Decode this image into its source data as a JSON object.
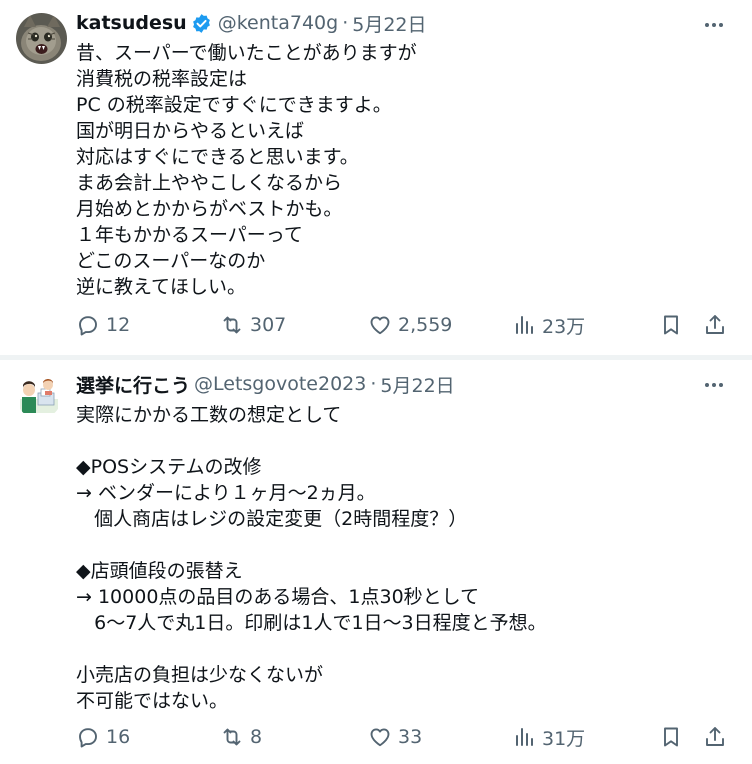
{
  "posts": [
    {
      "author_name": "katsudesu",
      "handle": "@kenta740g",
      "separator": "·",
      "date": "5月22日",
      "verified": true,
      "avatar_icon": "cat-avatar-icon",
      "text": "昔、スーパーで働いたことがありますが\n消費税の税率設定は\nPC の税率設定ですぐにできますよ。\n国が明日からやるといえば\n対応はすぐにできると思います。\nまあ会計上ややこしくなるから\n月始めとかからがベストかも。\n１年もかかるスーパーって\nどこのスーパーなのか\n逆に教えてほしい。",
      "replies": "12",
      "reposts": "307",
      "likes": "2,559",
      "views": "23万"
    },
    {
      "author_name": "選挙に行こう",
      "handle": "@Letsgovote2023",
      "separator": "·",
      "date": "5月22日",
      "verified": false,
      "avatar_icon": "voting-illustration-avatar-icon",
      "text": "実際にかかる工数の想定として\n\n◆POSシステムの改修\n→ ベンダーにより１ヶ月〜2ヵ月。\n   個人商店はレジの設定変更（2時間程度？）\n\n◆店頭値段の張替え\n→ 10000点の品目のある場合、1点30秒として\n   6〜7人で丸1日。印刷は1人で1日〜3日程度と予想。\n\n小売店の負担は少なくないが\n不可能ではない。",
      "replies": "16",
      "reposts": "8",
      "likes": "33",
      "views": "31万"
    }
  ],
  "colors": {
    "text": "#0f1419",
    "secondary": "#536471",
    "verified_blue": "#1d9bf0",
    "divider": "#eff3f4"
  }
}
